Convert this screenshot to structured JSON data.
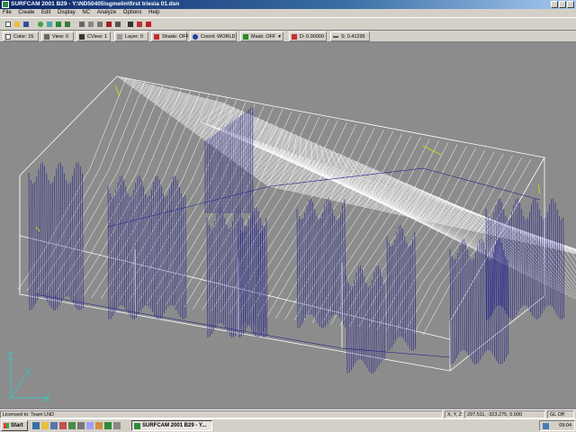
{
  "window": {
    "title": "SURFCAM 2001 B29 - Y:\\ND50405\\sgmelin\\first tries\\a 01.dsn"
  },
  "menu": [
    "File",
    "Create",
    "Edit",
    "Display",
    "NC",
    "Analyze",
    "Options",
    "Help"
  ],
  "status_row": {
    "color": "Color: 15",
    "view": "View: 0",
    "cview": "CView: 1",
    "layer": "Layer: 0",
    "shade": "Shade: OFF",
    "coord": "Coord: WORLD",
    "mask": "Mask: OFF",
    "d": "D: 0.00000",
    "s": "S: 0.41295"
  },
  "axes": {
    "z": "Z",
    "y": "Y",
    "x": "X"
  },
  "colors": {
    "viewport_bg": "#8c8c8c",
    "wireframe": "#ffffff",
    "toolpath": "#1a1a8c",
    "highlight": "#e0e000",
    "panel": "#d4d0c8"
  },
  "status_bar": {
    "license": "Licensed to: Team LND",
    "coord_label": "X, Y, Z:",
    "coord_value": "297.511, -323.275, 0.000",
    "gl": "GL Off"
  },
  "taskbar": {
    "start": "Start",
    "task": "SURFCAM 2001 B29 - Y...",
    "clock": "09:04"
  }
}
